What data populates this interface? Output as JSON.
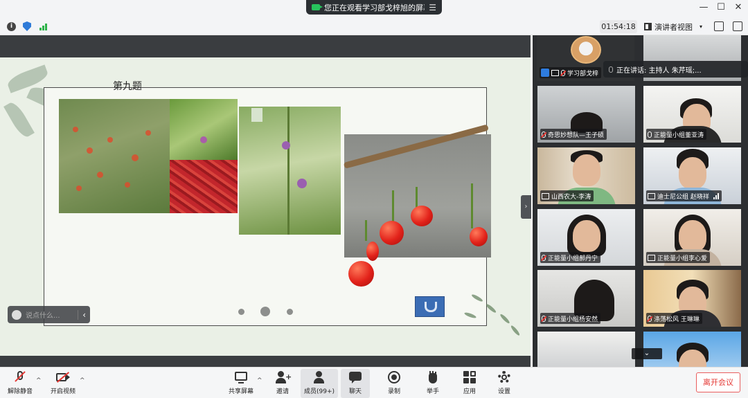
{
  "titlebar": {
    "share_notice": "您正在观看学习部戈梓旭的屏幕",
    "controls": [
      "—",
      "☐",
      "✕"
    ]
  },
  "infobar": {
    "timer": "01:54:18",
    "view_mode": "演讲者视图",
    "info_glyph": "i"
  },
  "slide": {
    "title": "第九题"
  },
  "chat": {
    "placeholder": "说点什么...",
    "chevron": "‹"
  },
  "panel": {
    "host_label": "学习部戈梓",
    "speaking_text": "正在讲话: 主持人 朱芹瑶;...",
    "collapse": "›",
    "scroll_down": "⌄",
    "tiles": [
      {
        "name": "奇思妙想队—王子硕"
      },
      {
        "name": "正能量小组董亚涛"
      },
      {
        "name": "山西农大-李涛"
      },
      {
        "name": "迪士尼公组 赵晓祥"
      },
      {
        "name": "正能量小组郝丹宁"
      },
      {
        "name": "正能量小组李心爱"
      },
      {
        "name": "正能量小组杨安然"
      },
      {
        "name": "涤荡松风   王琳琳"
      }
    ]
  },
  "toolbar": {
    "mute": "解除静音",
    "video": "开启视频",
    "share": "共享屏幕",
    "invite": "邀请",
    "members": "成员(99+)",
    "chat": "聊天",
    "record": "录制",
    "raise_hand": "举手",
    "apps": "应用",
    "settings": "设置",
    "leave": "离开会议",
    "caret": "^"
  },
  "colors": {
    "accent_blue": "#2e7ce0",
    "leave_red": "#e53935",
    "dark_panel": "#2c2e31"
  }
}
